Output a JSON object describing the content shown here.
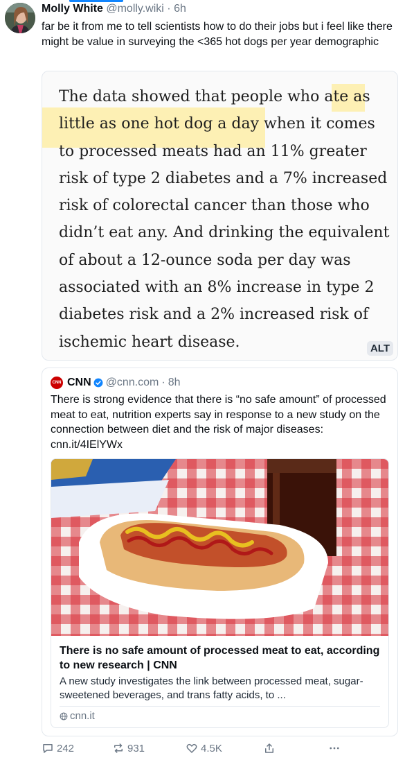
{
  "post": {
    "author_name": "Molly White",
    "author_handle": "@molly.wiki",
    "separator": "·",
    "time": "6h",
    "text": "far be it from me to tell scientists how to do their jobs but i feel like there might be value in surveying the <365 hot dogs per year demographic"
  },
  "image": {
    "quote_text": "The data showed that people who ate as little as one hot dog a day when it comes to processed meats had an 11% greater risk of type 2 diabetes and a 7% increased risk of colorectal cancer than those who didn’t eat any. And drinking the equivalent of about a 12-ounce soda per day was associated with an 8% increase in type 2 diabetes risk and a 2% increased risk of ischemic heart disease.",
    "alt_badge": "ALT",
    "highlight_color": "#fdf0b4"
  },
  "quoted_post": {
    "logo_text": "CNN",
    "author_name": "CNN",
    "author_handle": "@cnn.com",
    "separator": "·",
    "time": "8h",
    "verified_icon": "verified-check-icon",
    "text": "There is strong evidence that there is “no safe amount” of processed meat to eat, nutrition experts say in response to a new study on the connection between diet and the risk of major diseases: cnn.it/4IElYWx",
    "link_card": {
      "title": "There is no safe amount of processed meat to eat, according to new research | CNN",
      "description": "A new study investigates the link between processed meat, sugar-sweetened beverages, and trans fatty acids, to ...",
      "domain": "cnn.it"
    }
  },
  "actions": {
    "replies": "242",
    "reposts": "931",
    "likes": "4.5K"
  },
  "colors": {
    "accent": "#1185fe",
    "verified": "#1185fe",
    "cnn_red": "#cc0000",
    "muted_text": "#6b7785"
  }
}
